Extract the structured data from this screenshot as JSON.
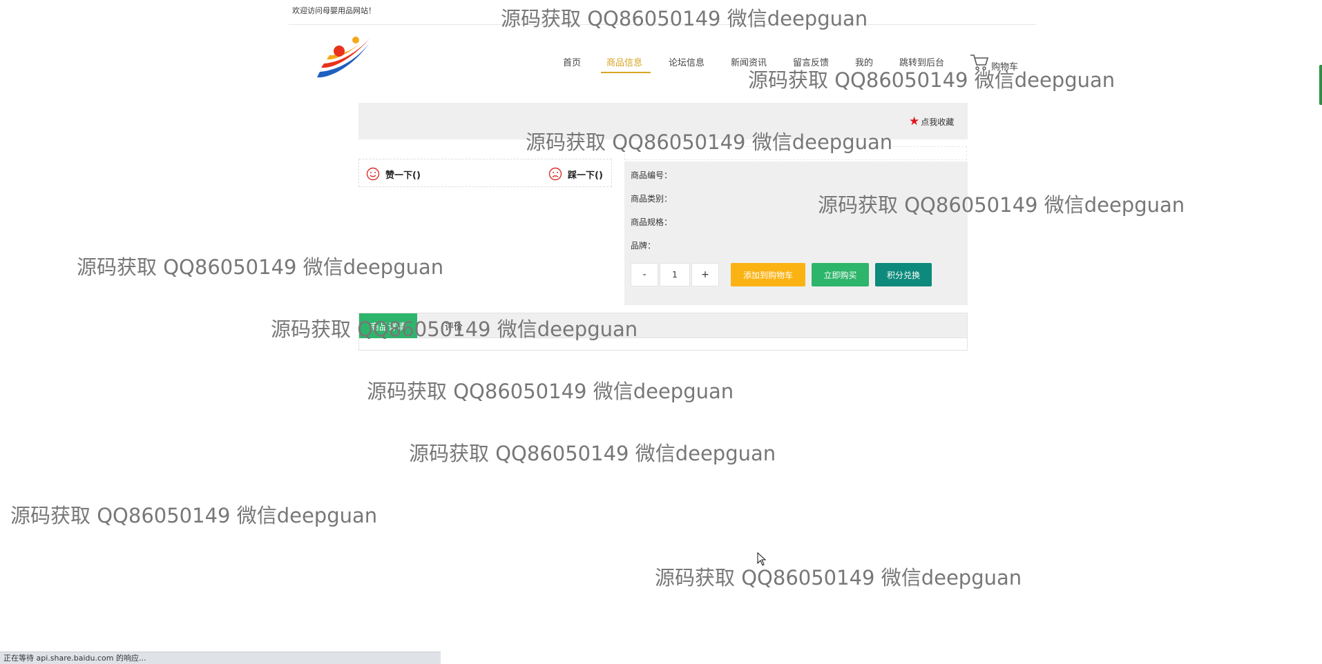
{
  "top_bar": {
    "welcome": "欢迎访问母婴用品网站！"
  },
  "nav": {
    "items": [
      "首页",
      "商品信息",
      "论坛信息",
      "新闻资讯",
      "留言反馈",
      "我的",
      "跳转到后台"
    ],
    "active_index": 1,
    "cart_label": "购物车"
  },
  "banner": {
    "favorite": "点我收藏"
  },
  "vote": {
    "like": "赞一下()",
    "dislike": "踩一下()"
  },
  "product": {
    "fields": [
      "商品编号：",
      "商品类别：",
      "商品规格：",
      "品牌："
    ],
    "quantity": "1",
    "minus": "-",
    "plus": "+",
    "buttons": [
      {
        "label": "添加到购物车",
        "color": "#fbb313"
      },
      {
        "label": "立即购买",
        "color": "#2db56b"
      },
      {
        "label": "积分兑换",
        "color": "#0d8a7b"
      }
    ]
  },
  "tabs": {
    "items": [
      "商品详情",
      "评价"
    ],
    "active_index": 0
  },
  "watermark": "源码获取 QQ86050149 微信deepguan",
  "status_bar": "正在等待 api.share.baidu.com 的响应...",
  "colors": {
    "accent": "#d7a423",
    "green": "#2db56b",
    "teal": "#0d8a7b",
    "orange": "#fbb313",
    "star": "#e0151d"
  }
}
